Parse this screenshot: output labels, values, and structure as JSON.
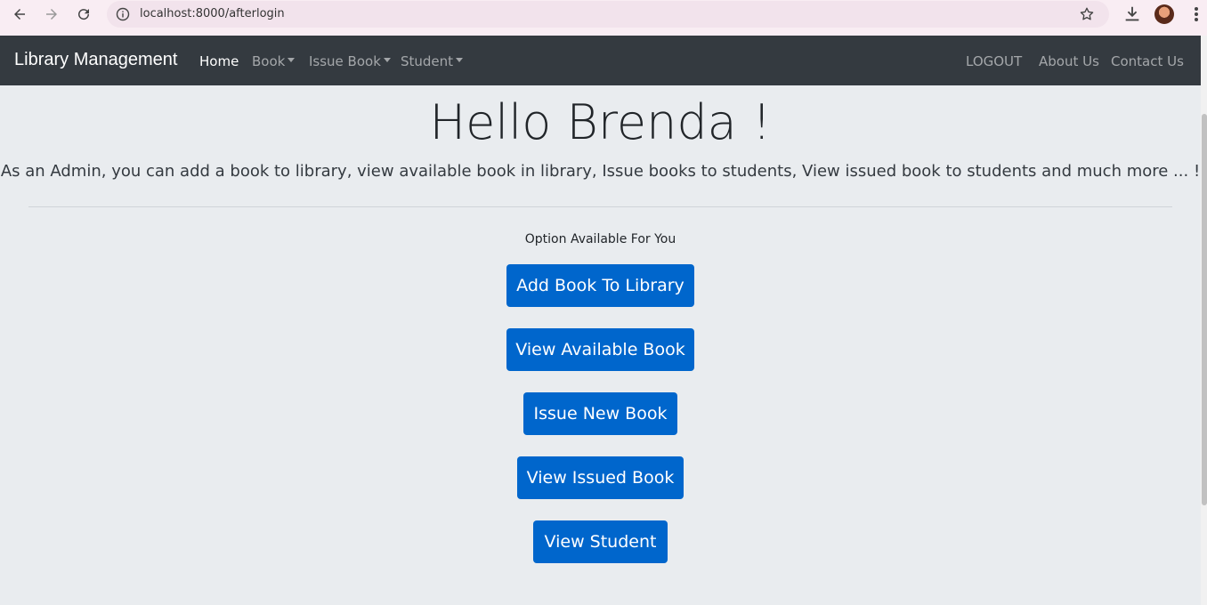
{
  "browser": {
    "url": "localhost:8000/afterlogin"
  },
  "navbar": {
    "brand": "Library Management",
    "links": {
      "home": "Home",
      "book": "Book",
      "issue_book": "Issue Book",
      "student": "Student",
      "logout": "LOGOUT",
      "about": "About Us",
      "contact": "Contact Us"
    }
  },
  "main": {
    "greeting": "Hello Brenda !",
    "lead": "As an Admin, you can add a book to library, view available book in library, Issue books to students, View issued book to students and much more ... !",
    "options_label": "Option Available For You",
    "buttons": {
      "add_book": "Add Book To Library",
      "view_available": "View Available Book",
      "issue_new": "Issue New Book",
      "view_issued": "View Issued Book",
      "view_student": "View Student"
    }
  },
  "colors": {
    "navbar_bg": "#343a40",
    "page_bg": "#e9ecef",
    "button_bg": "#0066cc"
  }
}
